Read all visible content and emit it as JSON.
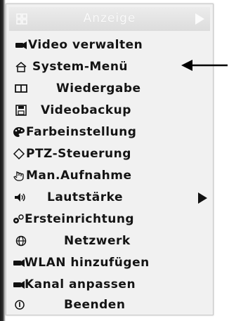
{
  "menu": {
    "header": {
      "title": "Anzeige",
      "icon": "grid-icon",
      "arrow": "triangle-right-icon"
    },
    "items": [
      {
        "label": "Video verwalten",
        "icon": "camera-icon"
      },
      {
        "label": "System-Menü",
        "icon": "home-icon"
      },
      {
        "label": "Wiedergabe",
        "icon": "playback-icon"
      },
      {
        "label": "Videobackup",
        "icon": "floppy-disk-icon"
      },
      {
        "label": "Farbeinstellung",
        "icon": "palette-icon"
      },
      {
        "label": "PTZ-Steuerung",
        "icon": "diamond-icon"
      },
      {
        "label": "Man.Aufnahme",
        "icon": "hand-icon"
      },
      {
        "label": "Lautstärke",
        "icon": "speaker-icon",
        "submenu": true
      },
      {
        "label": "Ersteinrichtung",
        "icon": "gear-icon"
      },
      {
        "label": "Netzwerk",
        "icon": "globe-icon"
      },
      {
        "label": "WLAN hinzufügen",
        "icon": "camera-icon"
      },
      {
        "label": "Kanal anpassen",
        "icon": "camera-icon"
      },
      {
        "label": "Beenden",
        "icon": "power-icon"
      }
    ]
  },
  "annotation": {
    "icon": "arrow-left-icon",
    "color": "#000000"
  },
  "colors": {
    "menu_bg": "#f1f1f1",
    "header_bg": "#dcdcdc",
    "text": "#141414"
  }
}
